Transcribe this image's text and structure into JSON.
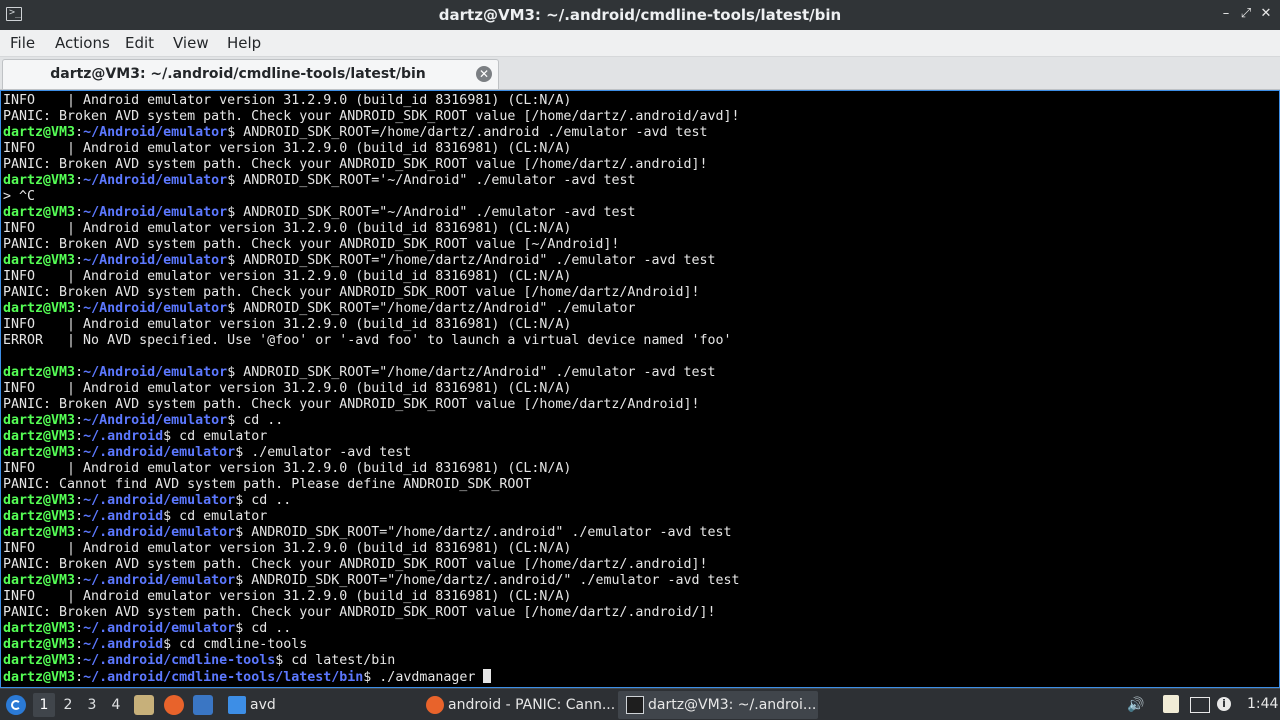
{
  "window": {
    "title": "dartz@VM3: ~/.android/cmdline-tools/latest/bin",
    "icon": "terminal-icon",
    "controls": {
      "minimize": "minimize-icon",
      "maximize": "maximize-icon",
      "close": "close-icon"
    }
  },
  "menu": {
    "file": "File",
    "actions": "Actions",
    "edit": "Edit",
    "view": "View",
    "help": "Help"
  },
  "tab": {
    "title": "dartz@VM3: ~/.android/cmdline-tools/latest/bin",
    "close_icon": "close-circle-icon"
  },
  "terminal": {
    "colors": {
      "user": "#55ff55",
      "path": "#5c78ff",
      "text": "#e6e6e6",
      "background": "#000000"
    },
    "lines": [
      {
        "text": "INFO    | Android emulator version 31.2.9.0 (build_id 8316981) (CL:N/A)"
      },
      {
        "text": "PANIC: Broken AVD system path. Check your ANDROID_SDK_ROOT value [/home/dartz/.android/avd]!"
      },
      {
        "user": "dartz@VM3",
        "path": "~/Android/emulator",
        "cmd": " ANDROID_SDK_ROOT=/home/dartz/.android ./emulator -avd test"
      },
      {
        "text": "INFO    | Android emulator version 31.2.9.0 (build_id 8316981) (CL:N/A)"
      },
      {
        "text": "PANIC: Broken AVD system path. Check your ANDROID_SDK_ROOT value [/home/dartz/.android]!"
      },
      {
        "user": "dartz@VM3",
        "path": "~/Android/emulator",
        "cmd": " ANDROID_SDK_ROOT='~/Android\" ./emulator -avd test"
      },
      {
        "text": "> ^C"
      },
      {
        "user": "dartz@VM3",
        "path": "~/Android/emulator",
        "cmd": " ANDROID_SDK_ROOT=\"~/Android\" ./emulator -avd test"
      },
      {
        "text": "INFO    | Android emulator version 31.2.9.0 (build_id 8316981) (CL:N/A)"
      },
      {
        "text": "PANIC: Broken AVD system path. Check your ANDROID_SDK_ROOT value [~/Android]!"
      },
      {
        "user": "dartz@VM3",
        "path": "~/Android/emulator",
        "cmd": " ANDROID_SDK_ROOT=\"/home/dartz/Android\" ./emulator -avd test"
      },
      {
        "text": "INFO    | Android emulator version 31.2.9.0 (build_id 8316981) (CL:N/A)"
      },
      {
        "text": "PANIC: Broken AVD system path. Check your ANDROID_SDK_ROOT value [/home/dartz/Android]!"
      },
      {
        "user": "dartz@VM3",
        "path": "~/Android/emulator",
        "cmd": " ANDROID_SDK_ROOT=\"/home/dartz/Android\" ./emulator"
      },
      {
        "text": "INFO    | Android emulator version 31.2.9.0 (build_id 8316981) (CL:N/A)"
      },
      {
        "text": "ERROR   | No AVD specified. Use '@foo' or '-avd foo' to launch a virtual device named 'foo'"
      },
      {
        "text": ""
      },
      {
        "user": "dartz@VM3",
        "path": "~/Android/emulator",
        "cmd": " ANDROID_SDK_ROOT=\"/home/dartz/Android\" ./emulator -avd test"
      },
      {
        "text": "INFO    | Android emulator version 31.2.9.0 (build_id 8316981) (CL:N/A)"
      },
      {
        "text": "PANIC: Broken AVD system path. Check your ANDROID_SDK_ROOT value [/home/dartz/Android]!"
      },
      {
        "user": "dartz@VM3",
        "path": "~/Android/emulator",
        "cmd": " cd .."
      },
      {
        "user": "dartz@VM3",
        "path": "~/.android",
        "cmd": " cd emulator"
      },
      {
        "user": "dartz@VM3",
        "path": "~/.android/emulator",
        "cmd": " ./emulator -avd test"
      },
      {
        "text": "INFO    | Android emulator version 31.2.9.0 (build_id 8316981) (CL:N/A)"
      },
      {
        "text": "PANIC: Cannot find AVD system path. Please define ANDROID_SDK_ROOT"
      },
      {
        "user": "dartz@VM3",
        "path": "~/.android/emulator",
        "cmd": " cd .."
      },
      {
        "user": "dartz@VM3",
        "path": "~/.android",
        "cmd": " cd emulator"
      },
      {
        "user": "dartz@VM3",
        "path": "~/.android/emulator",
        "cmd": " ANDROID_SDK_ROOT=\"/home/dartz/.android\" ./emulator -avd test"
      },
      {
        "text": "INFO    | Android emulator version 31.2.9.0 (build_id 8316981) (CL:N/A)"
      },
      {
        "text": "PANIC: Broken AVD system path. Check your ANDROID_SDK_ROOT value [/home/dartz/.android]!"
      },
      {
        "user": "dartz@VM3",
        "path": "~/.android/emulator",
        "cmd": " ANDROID_SDK_ROOT=\"/home/dartz/.android/\" ./emulator -avd test"
      },
      {
        "text": "INFO    | Android emulator version 31.2.9.0 (build_id 8316981) (CL:N/A)"
      },
      {
        "text": "PANIC: Broken AVD system path. Check your ANDROID_SDK_ROOT value [/home/dartz/.android/]!"
      },
      {
        "user": "dartz@VM3",
        "path": "~/.android/emulator",
        "cmd": " cd .."
      },
      {
        "user": "dartz@VM3",
        "path": "~/.android",
        "cmd": " cd cmdline-tools"
      },
      {
        "user": "dartz@VM3",
        "path": "~/.android/cmdline-tools",
        "cmd": " cd latest/bin"
      },
      {
        "user": "dartz@VM3",
        "path": "~/.android/cmdline-tools/latest/bin",
        "cmd": " ./avdmanager ",
        "cursor": true
      }
    ]
  },
  "taskbar": {
    "launcher_icon": "app-launcher-icon",
    "desktops": [
      "1",
      "2",
      "3",
      "4"
    ],
    "active_desktop": "1",
    "quicklaunch": [
      {
        "icon": "file-manager-icon"
      },
      {
        "icon": "firefox-icon"
      },
      {
        "icon": "show-desktop-icon"
      }
    ],
    "folder_label": "avd",
    "folder_icon": "folder-icon",
    "tasks": [
      {
        "label": "android - PANIC: Cann...",
        "icon": "firefox-icon",
        "active": false
      },
      {
        "label": "dartz@VM3: ~/.androi...",
        "icon": "terminal-icon",
        "active": true
      }
    ],
    "tray": [
      {
        "icon": "volume-icon"
      },
      {
        "icon": "clipboard-icon"
      },
      {
        "icon": "network-icon"
      },
      {
        "icon": "info-icon"
      }
    ],
    "clock": "1:44"
  }
}
